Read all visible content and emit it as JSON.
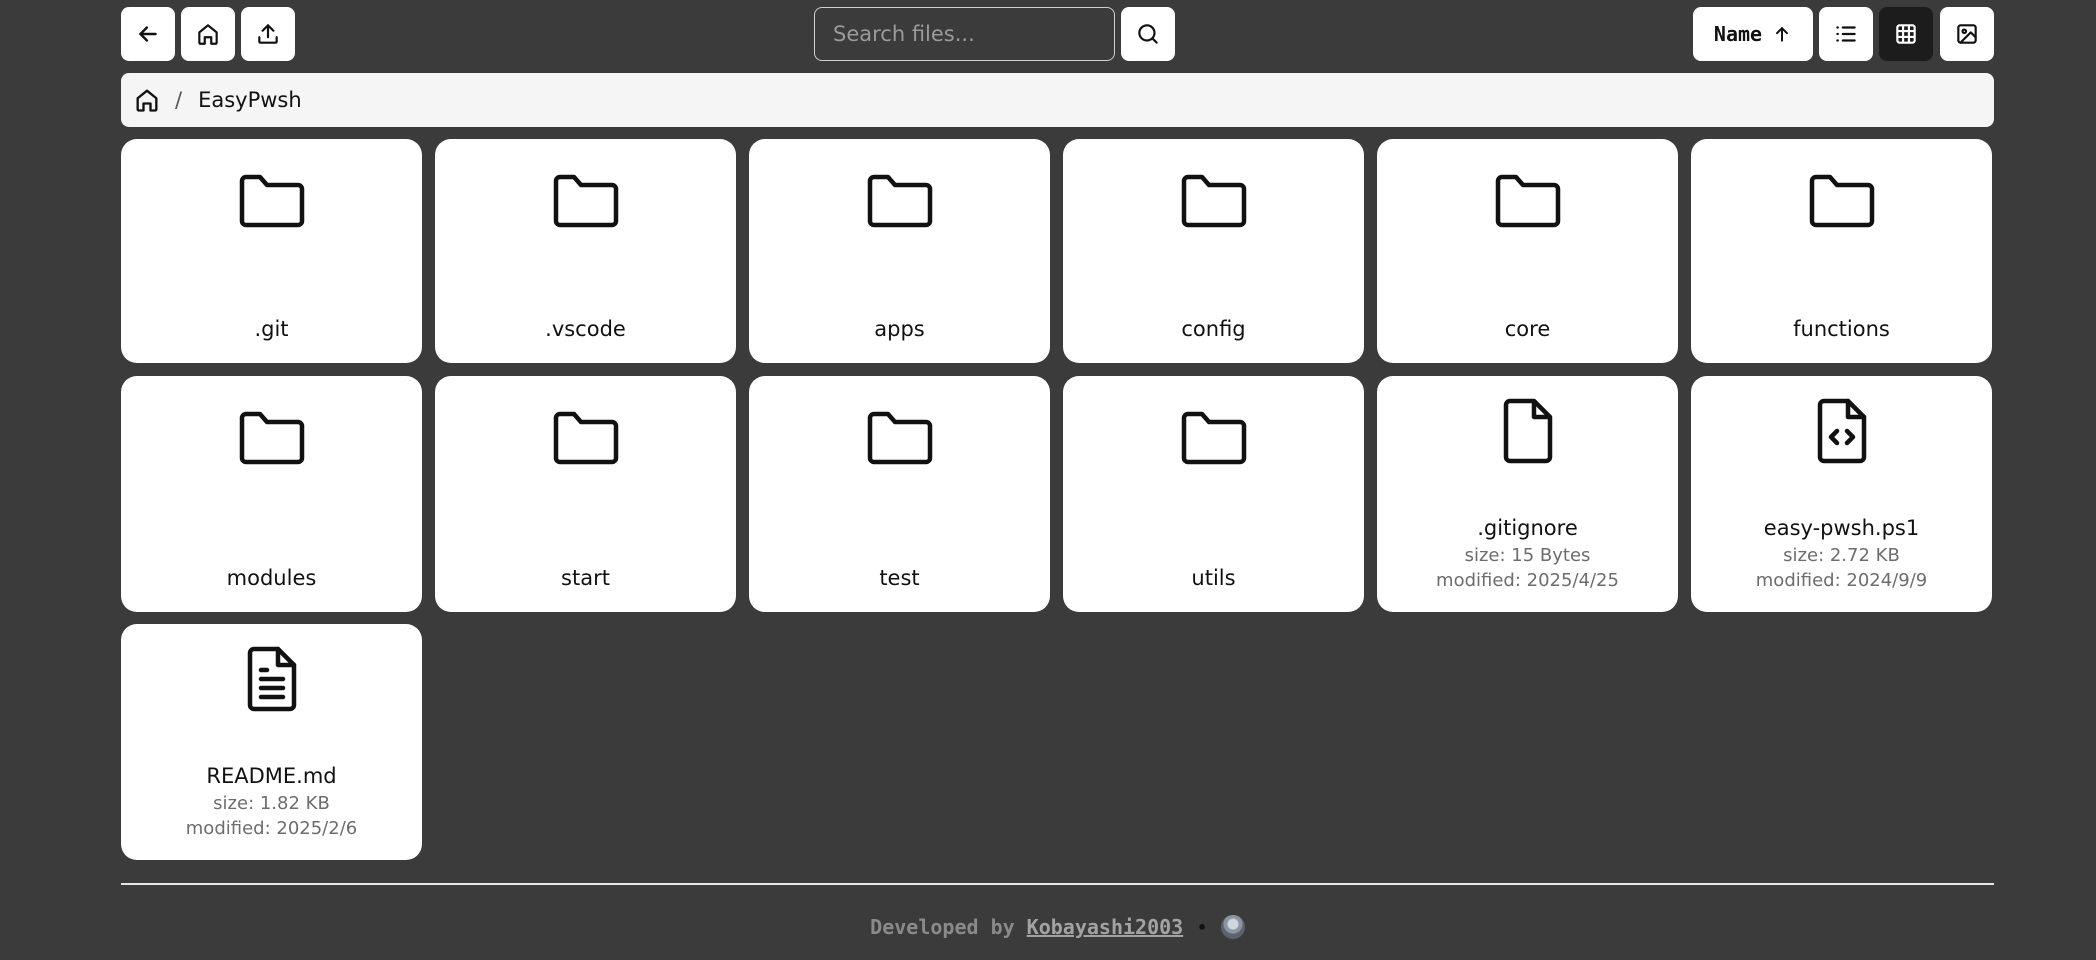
{
  "toolbar": {
    "back_icon": "arrow-left-icon",
    "home_icon": "home-icon",
    "upload_icon": "upload-icon",
    "search": {
      "placeholder": "Search files...",
      "value": ""
    },
    "search_icon": "search-icon",
    "sort": {
      "label": "Name",
      "direction_icon": "arrow-up-icon"
    },
    "view_list_icon": "list-icon",
    "view_grid_icon": "grid-icon",
    "view_gallery_icon": "image-icon",
    "active_view": "grid"
  },
  "breadcrumb": {
    "home_icon": "home-icon",
    "separator": "/",
    "items": [
      "EasyPwsh"
    ]
  },
  "items": [
    {
      "name": ".git",
      "type": "folder"
    },
    {
      "name": ".vscode",
      "type": "folder"
    },
    {
      "name": "apps",
      "type": "folder"
    },
    {
      "name": "config",
      "type": "folder"
    },
    {
      "name": "core",
      "type": "folder"
    },
    {
      "name": "functions",
      "type": "folder"
    },
    {
      "name": "modules",
      "type": "folder"
    },
    {
      "name": "start",
      "type": "folder"
    },
    {
      "name": "test",
      "type": "folder"
    },
    {
      "name": "utils",
      "type": "folder"
    },
    {
      "name": ".gitignore",
      "type": "file",
      "size": "size: 15 Bytes",
      "modified": "modified: 2025/4/25"
    },
    {
      "name": "easy-pwsh.ps1",
      "type": "code",
      "size": "size: 2.72 KB",
      "modified": "modified: 2024/9/9"
    },
    {
      "name": "README.md",
      "type": "text",
      "size": "size: 1.82 KB",
      "modified": "modified: 2025/2/6"
    }
  ],
  "footer": {
    "prefix": "Developed by",
    "author": "Kobayashi2003",
    "dot": "•"
  },
  "colors": {
    "background": "#3b3b3b",
    "card": "#ffffff",
    "active_button": "#1c1c1c",
    "meta_text": "#6d6d6d"
  }
}
